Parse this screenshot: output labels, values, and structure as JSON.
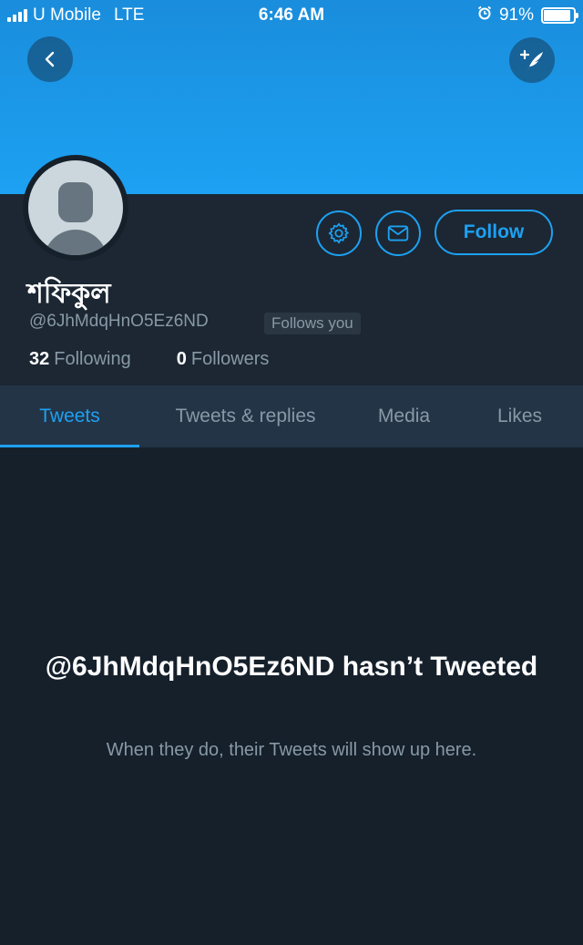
{
  "status_bar": {
    "carrier": "U Mobile",
    "network": "LTE",
    "time": "6:46 AM",
    "battery_percent": "91%",
    "battery_level": 0.91,
    "alarm_icon": "alarm-clock-icon"
  },
  "nav": {
    "back_icon": "chevron-left-icon",
    "compose_icon": "compose-tweet-icon"
  },
  "profile": {
    "display_name": "শফিকুল",
    "handle": "@6JhMdqHnO5Ez6ND",
    "follows_you_label": "Follows you",
    "following_count": "32",
    "following_label": "Following",
    "followers_count": "0",
    "followers_label": "Followers",
    "follow_button_label": "Follow",
    "settings_icon": "gear-icon",
    "message_icon": "envelope-icon"
  },
  "tabs": [
    {
      "label": "Tweets",
      "active": true
    },
    {
      "label": "Tweets & replies",
      "active": false
    },
    {
      "label": "Media",
      "active": false
    },
    {
      "label": "Likes",
      "active": false
    }
  ],
  "empty_state": {
    "title": "@6JhMdqHnO5Ez6ND hasn’t Tweeted",
    "subtitle": "When they do, their Tweets will show up here."
  },
  "colors": {
    "accent": "#1da1f2",
    "background": "#15202b",
    "header_bg": "#1c2733",
    "tabs_bg": "#243447",
    "secondary_text": "#8899a6"
  }
}
